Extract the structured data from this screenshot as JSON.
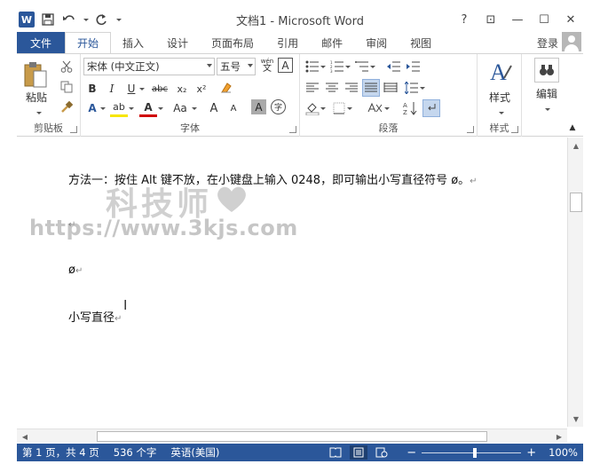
{
  "app": {
    "window_title": "文档1 - Microsoft Word",
    "accent_color": "#2b579a"
  },
  "title_controls": {
    "help": "?",
    "ribbon_display": "⊡",
    "minimize": "—",
    "maximize": "☐",
    "close": "✕"
  },
  "tabs": {
    "file": "文件",
    "items": [
      "开始",
      "插入",
      "设计",
      "页面布局",
      "引用",
      "邮件",
      "审阅",
      "视图"
    ],
    "active": "开始",
    "signin": "登录"
  },
  "ribbon": {
    "clipboard": {
      "label": "剪贴板",
      "paste_label": "粘贴"
    },
    "font": {
      "label": "字体",
      "font_name": "宋体 (中文正文)",
      "font_size": "五号",
      "phonetic": "wén",
      "phonetic_char": "文",
      "border_char": "A",
      "bold": "B",
      "italic": "I",
      "underline": "U",
      "strike": "abc",
      "subscript": "x₂",
      "superscript": "x²",
      "text_effect": "A",
      "highlight": "ab",
      "font_color": "A",
      "change_case": "Aa",
      "grow": "A",
      "shrink": "A",
      "char_shading": "A",
      "enclose": "字"
    },
    "paragraph": {
      "label": "段落"
    },
    "styles": {
      "label": "样式",
      "button_label": "样式"
    },
    "editing": {
      "button_label": "编辑"
    }
  },
  "document": {
    "lines": [
      "方法一：按住 Alt 键不放，在小键盘上输入 0248，即可输出小写直径符号 ø。",
      "",
      "ø",
      "小写直径"
    ],
    "paragraph_mark": "↵",
    "watermark_text": "科技师",
    "watermark_url": "https://www.3kjs.com"
  },
  "statusbar": {
    "page": "第 1 页，共 4 页",
    "words": "536 个字",
    "language": "英语(美国)",
    "zoom_minus": "−",
    "zoom_plus": "+",
    "zoom": "100%",
    "zoom_level_percent": 100
  }
}
